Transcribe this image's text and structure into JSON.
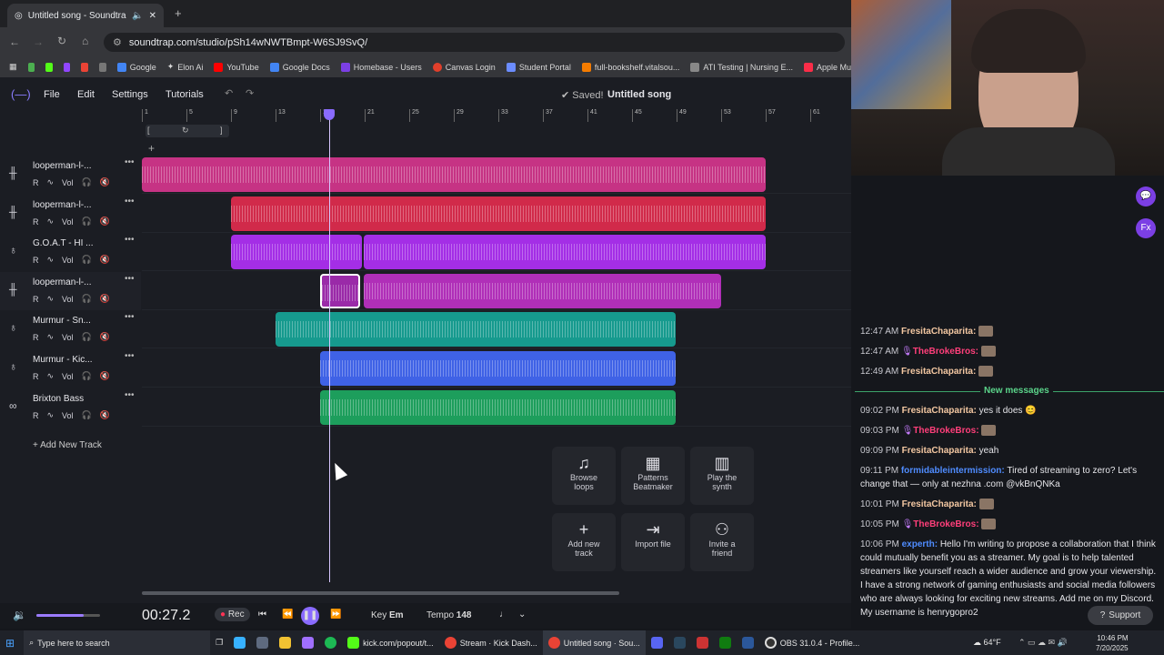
{
  "browser": {
    "tab_title": "Untitled song - Soundtrap",
    "url": "soundtrap.com/studio/pSh14wNWTBmpt-W6SJ9SvQ/",
    "bookmarks": [
      "Google",
      "Elon Ai",
      "YouTube",
      "Google Docs",
      "Homebase - Users",
      "Canvas Login",
      "Student Portal",
      "full-bookshelf.vitalsou...",
      "ATI Testing | Nursing E...",
      "Apple Mu"
    ]
  },
  "menu": {
    "file": "File",
    "edit": "Edit",
    "settings": "Settings",
    "tutorials": "Tutorials",
    "saved": "Saved!",
    "song_title": "Untitled song"
  },
  "ruler_ticks": [
    "1",
    "5",
    "9",
    "13",
    "17",
    "21",
    "25",
    "29",
    "33",
    "37",
    "41",
    "45",
    "49",
    "53",
    "57",
    "61"
  ],
  "tracks": [
    {
      "name": "looperman-l-...",
      "icon": "waveform-icon",
      "color": "#c63384"
    },
    {
      "name": "looperman-l-...",
      "icon": "waveform-icon",
      "color": "#d12a4a"
    },
    {
      "name": "G.O.A.T - HI ...",
      "icon": "drum-icon",
      "color": "#a42ee6"
    },
    {
      "name": "looperman-l-...",
      "icon": "waveform-icon",
      "color": "#b02fb8"
    },
    {
      "name": "Murmur - Sn...",
      "icon": "drum-icon",
      "color": "#169a8e"
    },
    {
      "name": "Murmur - Kic...",
      "icon": "drum-icon",
      "color": "#3f62e6"
    },
    {
      "name": "Brixton Bass",
      "icon": "keys-icon",
      "color": "#1d9e5c"
    }
  ],
  "track_controls": {
    "r": "R",
    "vol": "Vol"
  },
  "add_track": "Add New Track",
  "tiles": [
    {
      "label1": "Browse",
      "label2": "loops"
    },
    {
      "label1": "Patterns",
      "label2": "Beatmaker"
    },
    {
      "label1": "Play the",
      "label2": "synth"
    },
    {
      "label1": "Add new",
      "label2": "track"
    },
    {
      "label1": "Import file",
      "label2": ""
    },
    {
      "label1": "Invite a",
      "label2": "friend"
    }
  ],
  "transport": {
    "time": "00:27.2",
    "rec": "Rec",
    "key_label": "Key",
    "key": "Em",
    "tempo_label": "Tempo",
    "tempo": "148"
  },
  "chat": {
    "new_messages": "New messages",
    "msgs": [
      {
        "time": "12:47 AM",
        "user": "FresitaChaparita:",
        "text": ""
      },
      {
        "time": "12:47 AM",
        "user": "TheBrokeBros:",
        "text": ""
      },
      {
        "time": "12:49 AM",
        "user": "FresitaChaparita:",
        "text": ""
      },
      {
        "time": "09:02 PM",
        "user": "FresitaChaparita:",
        "text": "yes it does 😊"
      },
      {
        "time": "09:03 PM",
        "user": "TheBrokeBros:",
        "text": ""
      },
      {
        "time": "09:09 PM",
        "user": "FresitaChaparita:",
        "text": "yeah"
      },
      {
        "time": "09:11 PM",
        "user": "formidableintermission:",
        "text": "Tired of streaming to zero? Let's change that — only at nezhna .com @vkBnQNKa"
      },
      {
        "time": "10:01 PM",
        "user": "FresitaChaparita:",
        "text": ""
      },
      {
        "time": "10:05 PM",
        "user": "TheBrokeBros:",
        "text": ""
      },
      {
        "time": "10:06 PM",
        "user": "experth:",
        "text": "Hello I'm writing to propose a collaboration that I think could mutually benefit you as a streamer. My goal is to help talented streamers like yourself reach a wider audience and grow your viewership. I have a strong network of gaming enthusiasts and social media followers who are always looking for exciting new streams. Add me on my Discord. My username is henrygopro2"
      }
    ],
    "support": "Support"
  },
  "taskbar": {
    "search": "Type here to search",
    "apps": [
      "kick.com/popout/t...",
      "Stream · Kick Dash...",
      "Untitled song · Sou...",
      "OBS 31.0.4 - Profile..."
    ],
    "weather": "64°F",
    "time": "10:46 PM",
    "date": "7/20/2025"
  }
}
